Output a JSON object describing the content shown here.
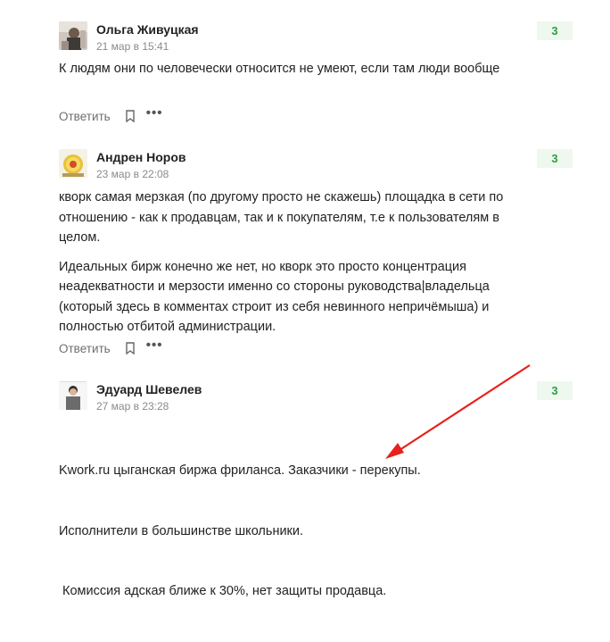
{
  "comments": [
    {
      "author": "Ольга Живуцкая",
      "date": "21 мар в 15:41",
      "rating": "3",
      "paragraphs": [
        "К людям они по человечески относится не умеют, если там люди вообще"
      ],
      "reply_label": "Ответить"
    },
    {
      "author": "Андрен Норов",
      "date": "23 мар в 22:08",
      "rating": "3",
      "paragraphs": [
        "кворк самая мерзкая (по другому просто не скажешь) площадка в сети по отношению - как к продавцам, так и к покупателям, т.е к пользователям в целом.",
        "Идеальных бирж конечно же нет, но кворк это просто концентрация неадекватности и мерзости именно со стороны руководства|владельца (который здесь в комментах строит из себя невинного непричёмыша) и полностью отбитой администрации."
      ],
      "reply_label": "Ответить"
    },
    {
      "author": "Эдуард Шевелев",
      "date": "27 мар в 23:28",
      "rating": "3",
      "lines": [
        "Kwork.ru цыганская биржа фриланса. Заказчики - перекупы.",
        "Исполнители в большинстве школьники.",
        " Комиссия адская ближе к 30%, нет защиты продавца."
      ]
    }
  ],
  "colors": {
    "rating_bg": "#eef8ee",
    "rating_text": "#2f9e44",
    "annotation_arrow": "#e8211c"
  }
}
